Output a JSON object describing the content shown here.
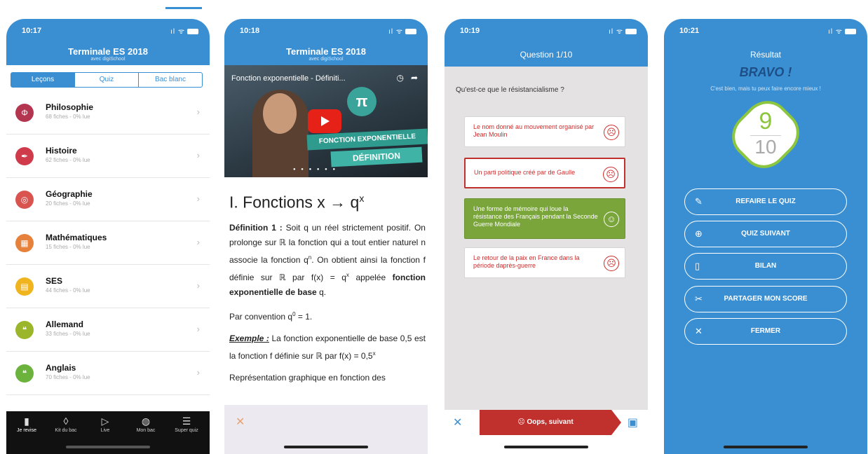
{
  "colors": {
    "primary": "#3a8fd3",
    "red": "#c0312e",
    "green": "#8cc63f",
    "dark": "#111111"
  },
  "screen1": {
    "time": "10:17",
    "header": {
      "title": "Terminale ES 2018",
      "subtitle": "avec digiSchool"
    },
    "segments": [
      "Leçons",
      "Quiz",
      "Bac blanc"
    ],
    "subjects": [
      {
        "name": "Philosophie",
        "meta": "68 fiches - 0% lue",
        "icon": "phi-icon",
        "color": "#b33550",
        "glyph": "Φ"
      },
      {
        "name": "Histoire",
        "meta": "62 fiches - 0% lue",
        "icon": "quill-icon",
        "color": "#cf3b4a",
        "glyph": "✒"
      },
      {
        "name": "Géographie",
        "meta": "20 fiches - 0% lue",
        "icon": "compass-icon",
        "color": "#d9534f",
        "glyph": "◎"
      },
      {
        "name": "Mathématiques",
        "meta": "15 fiches - 0% lue",
        "icon": "calculator-icon",
        "color": "#e6813b",
        "glyph": "▦"
      },
      {
        "name": "SES",
        "meta": "44 fiches - 0% lue",
        "icon": "chart-icon",
        "color": "#f0b51e",
        "glyph": "▤"
      },
      {
        "name": "Allemand",
        "meta": "33 fiches - 0% lue",
        "icon": "speech-bubble-icon",
        "color": "#9bb62a",
        "glyph": "❝"
      },
      {
        "name": "Anglais",
        "meta": "70 fiches - 0% lue",
        "icon": "speech-bubble-icon",
        "color": "#6bb33d",
        "glyph": "❝"
      }
    ],
    "tabs": [
      {
        "label": "Je revise",
        "glyph": "▮"
      },
      {
        "label": "Kit du bac",
        "glyph": "◊"
      },
      {
        "label": "Live",
        "glyph": "▷"
      },
      {
        "label": "Mon bac",
        "glyph": "◍"
      },
      {
        "label": "Super quiz",
        "glyph": "☰"
      }
    ]
  },
  "screen2": {
    "time": "10:18",
    "header": {
      "title": "Terminale ES 2018",
      "subtitle": "avec digiSchool"
    },
    "video": {
      "title": "Fonction exponentielle - Définiti...",
      "banner1": "FONCTION EXPONENTIELLE",
      "banner2": "DÉFINITION",
      "pi": "π"
    },
    "heading": "I. Fonctions x → q",
    "heading_sup": "x",
    "def_label": "Définition 1 :",
    "def_text_1": "Soit q un réel strictement positif. On prolonge sur ℝ la fonction qui a tout entier naturel n associe la fonction q",
    "def_sup_n": "n",
    "def_text_2": ". On obtient ainsi la fonction f définie sur ℝ par f(x) = q",
    "def_sup_x": "x",
    "def_text_3": "appelée",
    "def_bold": "fonction exponentielle de base",
    "def_q": "q.",
    "convention": "Par convention q",
    "convention_sup": "0",
    "convention_end": " = 1.",
    "example_label": "Exemple :",
    "example_text": "La fonction exponentielle de base 0,5 est la fonction f définie sur ℝ par f(x) = 0,5",
    "example_sup": "x",
    "graph_text": "Représentation graphique en fonction des"
  },
  "screen3": {
    "time": "10:19",
    "title": "Question 1/10",
    "question": "Qu'est-ce que le résistancialisme ?",
    "answers": [
      {
        "text": "Le nom donné au mouvement organisé par Jean Moulin",
        "state": "wrong"
      },
      {
        "text": "Un parti politique créé par de Gaulle",
        "state": "selected"
      },
      {
        "text": "Une forme de mémoire qui loue la résistance des Français pendant la Seconde Guerre Mondiale",
        "state": "correct"
      },
      {
        "text": "Le retour de la paix en France dans la période daprès-guerre",
        "state": "wrong"
      }
    ],
    "next_label": "Oops, suivant"
  },
  "screen4": {
    "time": "10:21",
    "label": "Résultat",
    "bravo": "BRAVO !",
    "message": "C'est bien, mais tu peux faire encore mieux !",
    "score": "9",
    "total": "10",
    "buttons": [
      {
        "label": "REFAIRE LE QUIZ",
        "icon": "retry-clipboard-icon",
        "glyph": "✎"
      },
      {
        "label": "QUIZ SUIVANT",
        "icon": "next-clipboard-icon",
        "glyph": "⊕"
      },
      {
        "label": "BILAN",
        "icon": "scroll-icon",
        "glyph": "▯"
      },
      {
        "label": "PARTAGER MON SCORE",
        "icon": "share-icon",
        "glyph": "✂"
      },
      {
        "label": "FERMER",
        "icon": "close-icon",
        "glyph": "✕"
      }
    ]
  }
}
